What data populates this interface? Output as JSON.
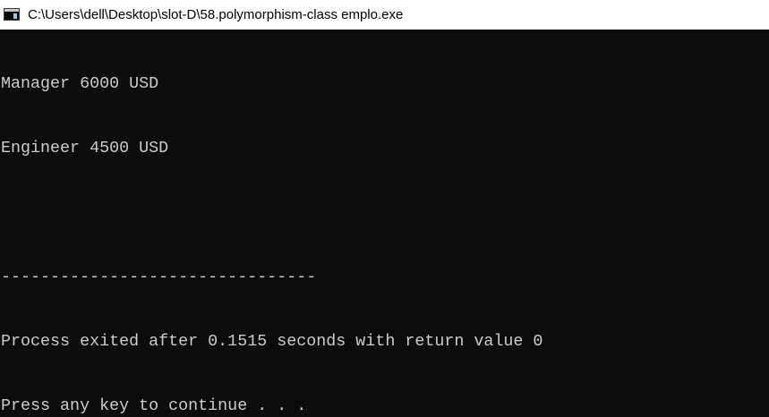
{
  "window": {
    "title": "C:\\Users\\dell\\Desktop\\slot-D\\58.polymorphism-class emplo.exe",
    "icon": "console-app-icon"
  },
  "console": {
    "lines": [
      "Manager 6000 USD",
      "Engineer 4500 USD",
      "",
      "--------------------------------",
      "Process exited after 0.1515 seconds with return value 0",
      "Press any key to continue . . ."
    ]
  },
  "colors": {
    "titlebar_bg": "#ffffff",
    "console_bg": "#0c0c0c",
    "console_text": "#cccccc"
  }
}
